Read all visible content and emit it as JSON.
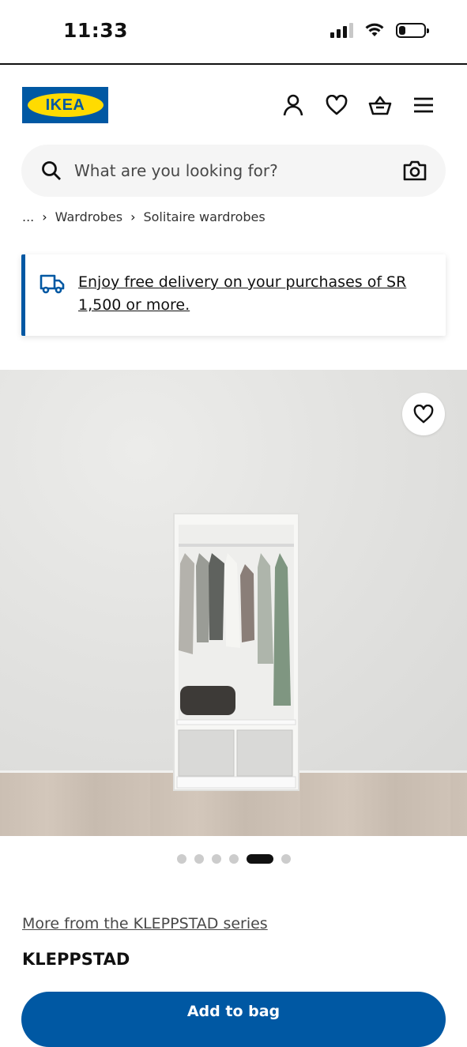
{
  "status_bar": {
    "time": "11:33",
    "icons": [
      "signal-icon",
      "wifi-icon",
      "battery-icon"
    ]
  },
  "header": {
    "logo_text": "IKEA",
    "icons": [
      "profile-icon",
      "heart-icon",
      "basket-icon",
      "menu-icon"
    ]
  },
  "search": {
    "placeholder": "What are you looking for?",
    "icons": [
      "search-icon",
      "camera-icon"
    ]
  },
  "breadcrumb": {
    "items": [
      "...",
      "Wardrobes",
      "Solitaire wardrobes"
    ]
  },
  "banner": {
    "text": "Enjoy free delivery on your purchases of SR 1,500 or more.",
    "icon": "truck-icon"
  },
  "gallery": {
    "image_count": 6,
    "active_index": 4
  },
  "product": {
    "series_link": "More from the KLEPPSTAD series",
    "name": "KLEPPSTAD",
    "add_button": "Add to bag"
  },
  "colors": {
    "brand_blue": "#0058a3",
    "brand_yellow": "#ffdb00"
  }
}
